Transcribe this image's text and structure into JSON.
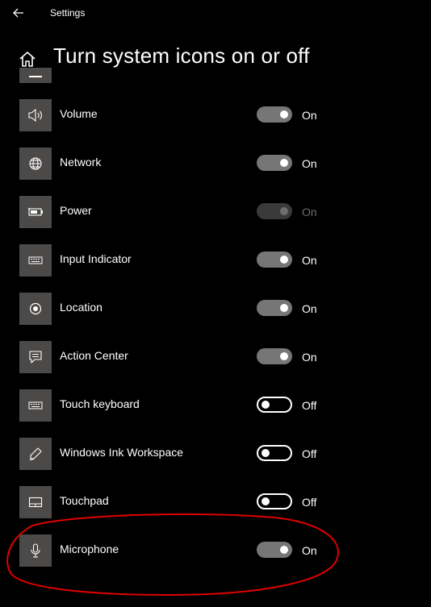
{
  "window": {
    "title": "Settings"
  },
  "page": {
    "title": "Turn system icons on or off"
  },
  "icons": {
    "back": "back-arrow-icon",
    "home": "home-icon"
  },
  "colors": {
    "annotation_circle": "#e00000",
    "tile_bg": "#4c4a48",
    "toggle_on": "#767676"
  },
  "items": [
    {
      "label": "Volume",
      "icon": "volume-icon",
      "state": "On",
      "toggle": "on"
    },
    {
      "label": "Network",
      "icon": "network-icon",
      "state": "On",
      "toggle": "on"
    },
    {
      "label": "Power",
      "icon": "battery-icon",
      "state": "On",
      "toggle": "on-disabled"
    },
    {
      "label": "Input Indicator",
      "icon": "keyboard-icon",
      "state": "On",
      "toggle": "on"
    },
    {
      "label": "Location",
      "icon": "location-icon",
      "state": "On",
      "toggle": "on"
    },
    {
      "label": "Action Center",
      "icon": "action-center-icon",
      "state": "On",
      "toggle": "on"
    },
    {
      "label": "Touch keyboard",
      "icon": "touch-keyboard-icon",
      "state": "Off",
      "toggle": "off"
    },
    {
      "label": "Windows Ink Workspace",
      "icon": "pen-icon",
      "state": "Off",
      "toggle": "off"
    },
    {
      "label": "Touchpad",
      "icon": "touchpad-icon",
      "state": "Off",
      "toggle": "off"
    },
    {
      "label": "Microphone",
      "icon": "microphone-icon",
      "state": "On",
      "toggle": "on"
    }
  ]
}
